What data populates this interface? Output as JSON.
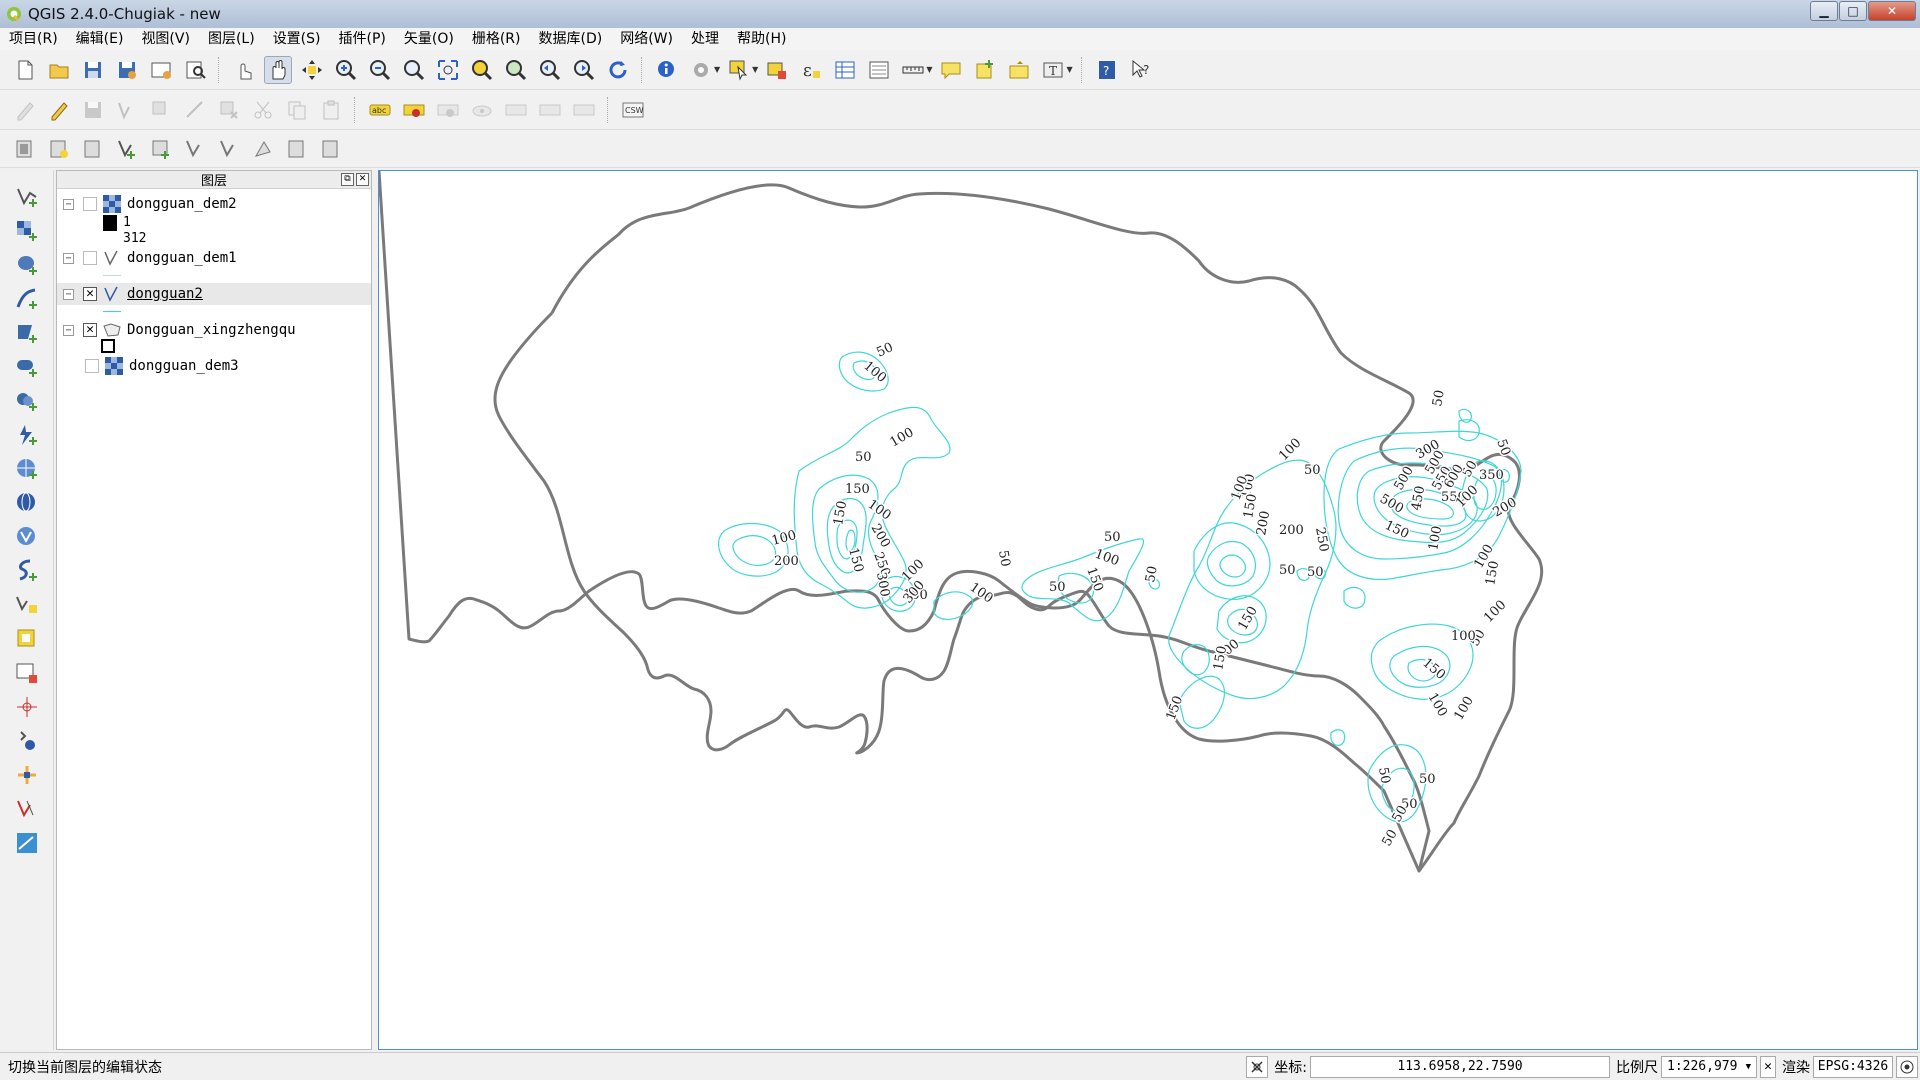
{
  "window": {
    "title": "QGIS 2.4.0-Chugiak - new",
    "min_glyph": "▁",
    "max_glyph": "□",
    "close_glyph": "✕"
  },
  "menubar": {
    "items": [
      "项目(R)",
      "编辑(E)",
      "视图(V)",
      "图层(L)",
      "设置(S)",
      "插件(P)",
      "矢量(O)",
      "栅格(R)",
      "数据库(D)",
      "网络(W)",
      "处理",
      "帮助(H)"
    ]
  },
  "layers_panel": {
    "title": "图层",
    "layers": [
      {
        "name": "dongguan_dem2",
        "type": "raster",
        "checked": false,
        "current": false,
        "selected": false
      },
      {
        "name": "dongguan_dem1",
        "type": "line",
        "checked": false,
        "current": false,
        "selected": false
      },
      {
        "name": "dongguan2",
        "type": "line",
        "checked": true,
        "current": true,
        "selected": true
      },
      {
        "name": "Dongguan_xingzhengqu",
        "type": "polygon",
        "checked": true,
        "current": false,
        "selected": false
      },
      {
        "name": "dongguan_dem3",
        "type": "raster",
        "checked": false,
        "current": false,
        "selected": false
      }
    ],
    "legend": {
      "dem2_min": "1",
      "dem2_max": "312"
    }
  },
  "map": {
    "boundary_color": "#777777",
    "contour_color": "#3fd6d6",
    "labels": [
      {
        "t": "50"
      },
      {
        "t": "100"
      },
      {
        "t": "100"
      },
      {
        "t": "50"
      },
      {
        "t": "150"
      },
      {
        "t": "100"
      },
      {
        "t": "150"
      },
      {
        "t": "200"
      },
      {
        "t": "250"
      },
      {
        "t": "150"
      },
      {
        "t": "100"
      },
      {
        "t": "200"
      },
      {
        "t": "300"
      },
      {
        "t": "100"
      },
      {
        "t": "150"
      },
      {
        "t": "300"
      },
      {
        "t": "100"
      },
      {
        "t": "50"
      },
      {
        "t": "50"
      },
      {
        "t": "100"
      },
      {
        "t": "150"
      },
      {
        "t": "50"
      },
      {
        "t": "50"
      },
      {
        "t": "100"
      },
      {
        "t": "50"
      },
      {
        "t": "150"
      },
      {
        "t": "100"
      },
      {
        "t": "150"
      },
      {
        "t": "200"
      },
      {
        "t": "250"
      },
      {
        "t": "200"
      },
      {
        "t": "50"
      },
      {
        "t": "50"
      },
      {
        "t": "50"
      },
      {
        "t": "100"
      },
      {
        "t": "150"
      },
      {
        "t": "100"
      },
      {
        "t": "150"
      },
      {
        "t": "150"
      },
      {
        "t": "50"
      },
      {
        "t": "300"
      },
      {
        "t": "500"
      },
      {
        "t": "550"
      },
      {
        "t": "600"
      },
      {
        "t": "500"
      },
      {
        "t": "450"
      },
      {
        "t": "550"
      },
      {
        "t": "350"
      },
      {
        "t": "100"
      },
      {
        "t": "200"
      },
      {
        "t": "500"
      },
      {
        "t": "100"
      },
      {
        "t": "100"
      },
      {
        "t": "50"
      },
      {
        "t": "150"
      },
      {
        "t": "100"
      },
      {
        "t": "100"
      },
      {
        "t": "150"
      },
      {
        "t": "100"
      },
      {
        "t": "100"
      },
      {
        "t": "50"
      },
      {
        "t": "50"
      },
      {
        "t": "50"
      },
      {
        "t": "50"
      },
      {
        "t": "50"
      },
      {
        "t": "50"
      }
    ]
  },
  "statusbar": {
    "message": "切换当前图层的编辑状态",
    "coord_label": "坐标:",
    "coord_value": "113.6958,22.7590",
    "scale_label": "比例尺",
    "scale_value": "1:226,979",
    "render_label": "渲染",
    "crs": "EPSG:4326"
  }
}
